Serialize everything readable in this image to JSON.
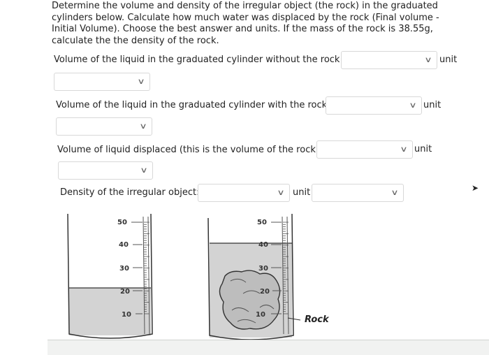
{
  "question": {
    "prompt": "Determine the volume and density of the irregular object (the rock) in the graduated cylinders below. Calculate how much water was displaced by the rock (Final volume - Initial Volume). Choose the best answer and units. If the mass of the rock is 38.55g, calculate the  the density of the rock."
  },
  "rows": [
    {
      "label": "Volume of the liquid in the graduated cylinder without the rock:",
      "value": "",
      "unit_label": "unit",
      "unit_value": ""
    },
    {
      "label": "Volume of the liquid in the graduated cylinder with the rock:",
      "value": "",
      "unit_label": "unit",
      "unit_value": ""
    },
    {
      "label": "Volume of liquid displaced (this is the volume of the rock):",
      "value": "",
      "unit_label": "unit",
      "unit_value": ""
    },
    {
      "label": "Density of the irregular object:",
      "value": "",
      "unit_label": "unit",
      "unit_value": ""
    }
  ],
  "figure": {
    "cylinder1_ticks": [
      "50",
      "40",
      "30",
      "20",
      "10"
    ],
    "cylinder2_ticks": [
      "50",
      "40",
      "30",
      "20",
      "10"
    ],
    "rock_label": "Rock"
  },
  "icons": {
    "dropdown": "chevron-down-icon",
    "cursor": "pointer-cursor-icon"
  },
  "colors": {
    "liquid": "#d0d0d0",
    "select_border": "#d8d8d8"
  }
}
